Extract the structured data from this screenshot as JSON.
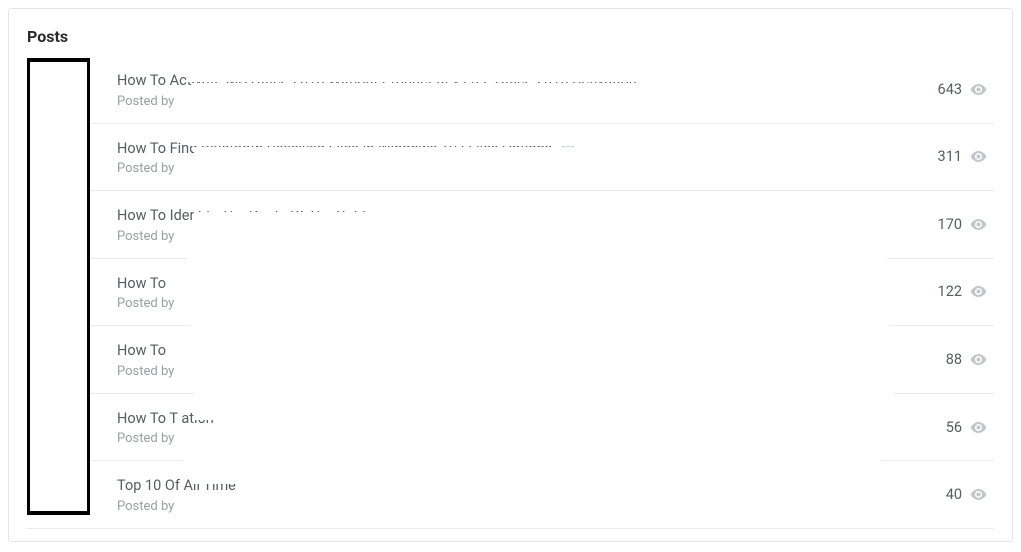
{
  "card": {
    "title": "Posts"
  },
  "posted_by_prefix": "Posted by ",
  "posts": [
    {
      "title": "How To Activate MS Office 2016 Without Product Key Free Office 2016 Activation",
      "author": "",
      "views": "643"
    },
    {
      "title": "How To Find Bluetooth Received Files In Windows 10 I                                                       Files   Options",
      "author": "",
      "views": "311",
      "has_q_icon": true
    },
    {
      "title": "How To Identify The Purity Of The Gold                                                                                                  ",
      "author": "",
      "views": "170"
    },
    {
      "title": "How To                                                                                                                                             ",
      "author": "",
      "views": "122"
    },
    {
      "title": "How To                                                                                                                                             ",
      "author": "",
      "views": "88"
    },
    {
      "title": "How To T                                                                                                       ation",
      "author": "",
      "views": "56"
    },
    {
      "title": "Top 10                                                                       Of All Time",
      "author": "",
      "views": "40"
    }
  ]
}
